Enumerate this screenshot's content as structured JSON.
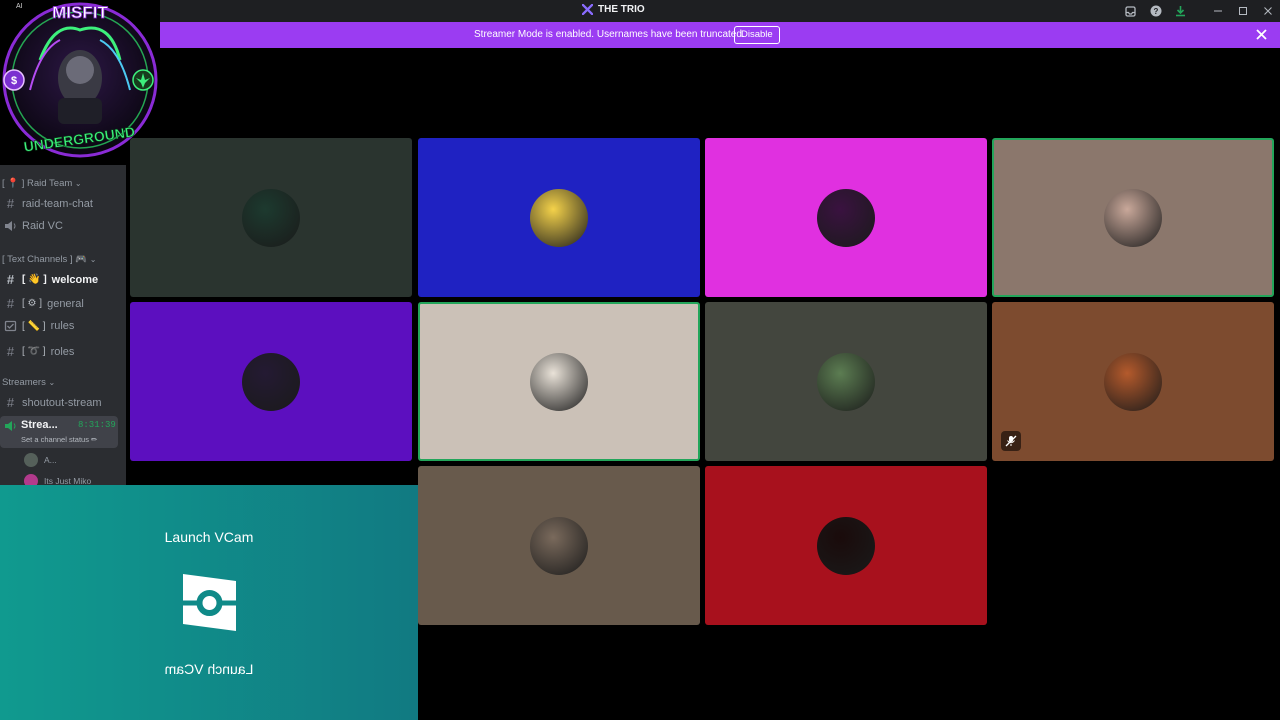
{
  "window": {
    "title": "THE TRIO"
  },
  "banner": {
    "message": "Streamer Mode is enabled. Usernames have been truncated.",
    "button_label": "Disable"
  },
  "logo": {
    "ai_badge": "AI",
    "text_top": "MISFIT",
    "text_bottom": "UNDERGROUND"
  },
  "sidebar": {
    "categories": [
      {
        "label": "[ 📍 ] Raid Team"
      },
      {
        "label": "[ Text Channels ] 🎮"
      },
      {
        "label": "Streamers"
      }
    ],
    "channels": [
      {
        "label": "raid-team-chat",
        "type": "text"
      },
      {
        "label": "Raid VC",
        "type": "voice"
      },
      {
        "label": "welcome",
        "symbol": "[ 👋 ]",
        "type": "text",
        "active": true
      },
      {
        "label": "general",
        "symbol": "[ ⚙ ]",
        "type": "text"
      },
      {
        "label": "rules",
        "symbol": "[ 📏 ]",
        "type": "rules"
      },
      {
        "label": "roles",
        "symbol": "[ ➰ ]",
        "type": "text"
      },
      {
        "label": "shoutout-stream",
        "type": "text"
      }
    ],
    "active_voice": {
      "name": "Strea...",
      "timer": "8:31:39",
      "status_hint": "Set a channel status ✏"
    },
    "voice_users": [
      {
        "name": "A..."
      },
      {
        "name": "Its Just Miko"
      }
    ]
  },
  "tiles": [
    {
      "bg": "#2a342f",
      "avatar_color": "#1d3a2f",
      "speaking": false
    },
    {
      "bg": "#1f22c2",
      "avatar_color": "#f4d24a",
      "speaking": false
    },
    {
      "bg": "#e030e0",
      "avatar_color": "#3a1240",
      "speaking": false
    },
    {
      "bg": "#8b776c",
      "avatar_color": "#c9a89a",
      "speaking": true
    },
    {
      "bg": "#5c0fbf",
      "avatar_color": "#241a33",
      "speaking": false
    },
    {
      "bg": "#cbc1b7",
      "avatar_color": "#e9e2d8",
      "speaking": true
    },
    {
      "bg": "#43463e",
      "avatar_color": "#5c7d52",
      "speaking": false
    },
    {
      "bg": "#7d4b2f",
      "avatar_color": "#b45a2c",
      "speaking": false,
      "muted": true
    },
    {
      "bg": "#685a4c",
      "avatar_color": "#7a6a5c",
      "speaking": false
    },
    {
      "bg": "#a8111d",
      "avatar_color": "#1a0b0b",
      "speaking": false
    }
  ],
  "vcam": {
    "title": "Launch VCam",
    "title_mirrored": "Launch VCam"
  },
  "colors": {
    "banner": "#9b3cf2",
    "speaking_ring": "#23a55a",
    "sidebar_bg": "#2b2d31"
  }
}
